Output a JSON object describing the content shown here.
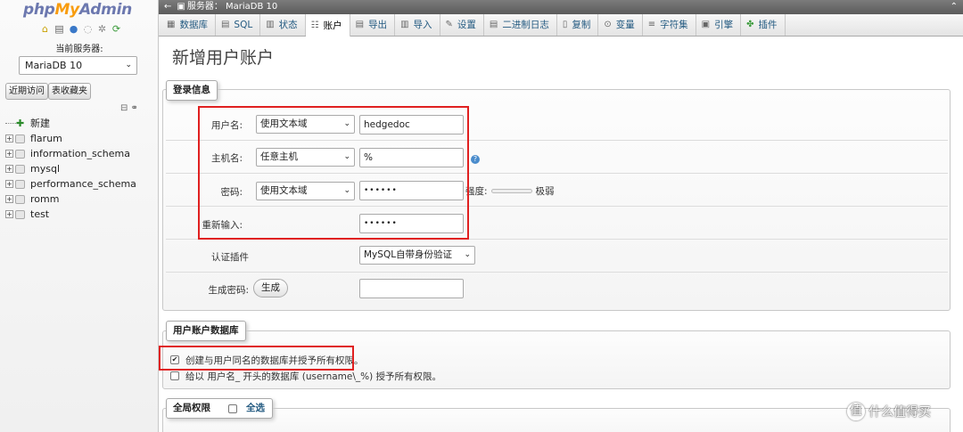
{
  "nav": {
    "logo_php": "php",
    "logo_my": "My",
    "logo_admin": "Admin",
    "current_server_label": "当前服务器:",
    "server_select": "MariaDB 10",
    "tab_recent": "近期访问",
    "tab_favorites": "表收藏夹",
    "tree": [
      {
        "name": "新建",
        "type": "new"
      },
      {
        "name": "flarum",
        "type": "db"
      },
      {
        "name": "information_schema",
        "type": "db"
      },
      {
        "name": "mysql",
        "type": "db"
      },
      {
        "name": "performance_schema",
        "type": "db"
      },
      {
        "name": "romm",
        "type": "db"
      },
      {
        "name": "test",
        "type": "db"
      }
    ]
  },
  "topbar": {
    "server_text": "服务器： MariaDB 10"
  },
  "tabs": [
    {
      "label": "数据库",
      "icon": "database-icon"
    },
    {
      "label": "SQL",
      "icon": "sql-icon"
    },
    {
      "label": "状态",
      "icon": "status-icon"
    },
    {
      "label": "账户",
      "icon": "users-icon",
      "active": true
    },
    {
      "label": "导出",
      "icon": "export-icon"
    },
    {
      "label": "导入",
      "icon": "import-icon"
    },
    {
      "label": "设置",
      "icon": "wrench-icon"
    },
    {
      "label": "二进制日志",
      "icon": "binlog-icon"
    },
    {
      "label": "复制",
      "icon": "replication-icon"
    },
    {
      "label": "变量",
      "icon": "variables-icon"
    },
    {
      "label": "字符集",
      "icon": "charset-icon"
    },
    {
      "label": "引擎",
      "icon": "engine-icon"
    },
    {
      "label": "插件",
      "icon": "plugin-icon"
    }
  ],
  "page_title": "新增用户账户",
  "login_info": {
    "legend": "登录信息",
    "username_label": "用户名:",
    "username_mode": "使用文本域",
    "username_value": "hedgedoc",
    "host_label": "主机名:",
    "host_mode": "任意主机",
    "host_value": "%",
    "password_label": "密码:",
    "password_mode": "使用文本域",
    "password_value": "••••••",
    "strength_label": "强度:",
    "strength_value": "极弱",
    "reenter_label": "重新输入:",
    "reenter_value": "••••••",
    "auth_plugin_label": "认证插件",
    "auth_plugin_value": "MySQL自带身份验证",
    "generate_label": "生成密码:",
    "generate_button": "生成"
  },
  "user_db": {
    "legend": "用户账户数据库",
    "option1": "创建与用户同名的数据库并授予所有权限。",
    "option1_checked": true,
    "option2": "给以 用户名_ 开头的数据库 (username\\_%) 授予所有权限。",
    "option2_checked": false
  },
  "global_priv": {
    "legend": "全局权限",
    "select_all": "全选"
  },
  "watermark": "什么值得买",
  "colors": {
    "highlight_box": "#e02020",
    "link": "#235a81"
  }
}
